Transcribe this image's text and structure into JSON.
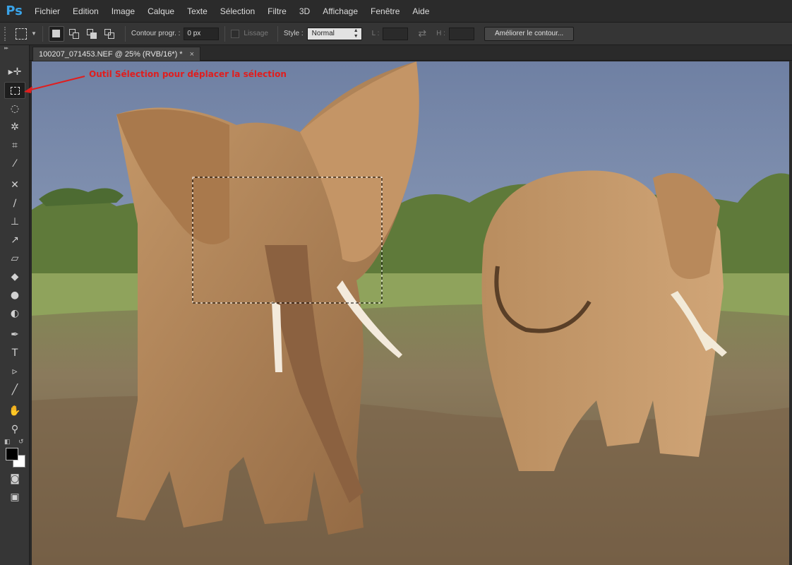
{
  "app": {
    "logo": "Ps",
    "accent": "#3aa3e8"
  },
  "menu": {
    "items": [
      "Fichier",
      "Edition",
      "Image",
      "Calque",
      "Texte",
      "Sélection",
      "Filtre",
      "3D",
      "Affichage",
      "Fenêtre",
      "Aide"
    ]
  },
  "options": {
    "tool_preset_icon": "rect-marquee-icon",
    "selection_modes": [
      "new-selection",
      "add-to-selection",
      "subtract-from-selection",
      "intersect-selection"
    ],
    "feather_label": "Contour progr. :",
    "feather_value": "0 px",
    "antialias_label": "Lissage",
    "style_label": "Style :",
    "style_value": "Normal",
    "width_label": "L :",
    "height_label": "H :",
    "refine_button": "Améliorer le contour..."
  },
  "document": {
    "tab_title": "100207_071453.NEF @ 25% (RVB/16*) *",
    "close_glyph": "×"
  },
  "toolbox": {
    "header": "▸▸",
    "tools": [
      "move",
      "rect-marquee",
      "lasso",
      "magic-wand",
      "crop",
      "eyedropper",
      "spot-healing",
      "brush",
      "clone-stamp",
      "history-brush",
      "eraser",
      "paint-bucket",
      "blur",
      "dodge",
      "pen",
      "type",
      "path-selection",
      "line",
      "hand",
      "zoom"
    ],
    "active_tool": "rect-marquee",
    "foreground_color": "#000000",
    "background_color": "#ffffff"
  },
  "annotation": {
    "text": "Outil Sélection pour déplacer la sélection",
    "color": "#e01e1e"
  }
}
